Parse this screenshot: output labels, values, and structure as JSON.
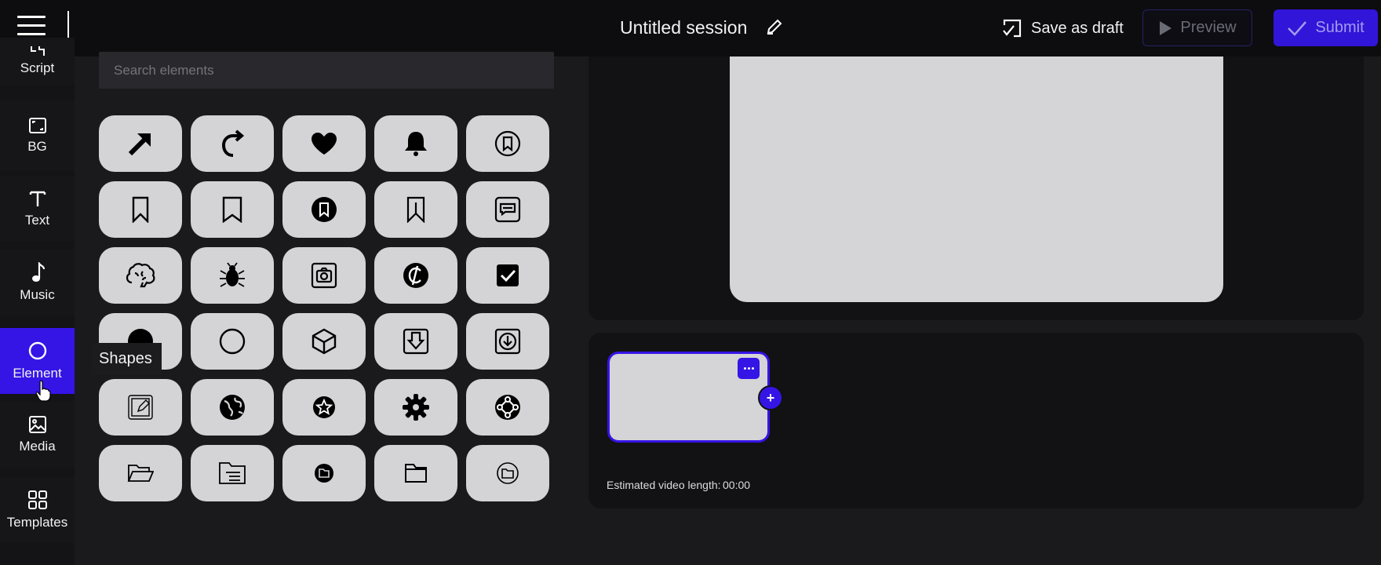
{
  "header": {
    "session_title": "Untitled session",
    "save_draft_label": "Save as draft",
    "preview_label": "Preview",
    "submit_label": "Submit"
  },
  "nav": {
    "items": [
      {
        "label": "Script",
        "icon": "script-icon"
      },
      {
        "label": "BG",
        "icon": "background-icon"
      },
      {
        "label": "Text",
        "icon": "text-icon"
      },
      {
        "label": "Music",
        "icon": "music-note-icon"
      },
      {
        "label": "Element",
        "icon": "circle-icon",
        "active": true
      },
      {
        "label": "Media",
        "icon": "image-icon"
      },
      {
        "label": "Templates",
        "icon": "templates-icon"
      }
    ]
  },
  "elements_panel": {
    "search_placeholder": "Search elements",
    "tooltip": "Shapes",
    "icons": [
      "arrow-up-right-icon",
      "redo-arrow-icon",
      "heart-icon",
      "bell-icon",
      "bookmark-circle-icon",
      "bookmark-icon",
      "bookmark-outline-icon",
      "bookmark-filled-circle-icon",
      "bookmark-alt-icon",
      "chat-box-icon",
      "brain-icon",
      "bug-icon",
      "camera-icon",
      "cent-icon",
      "checkbox-checked-icon",
      "circle-filled-icon",
      "circle-outline-icon",
      "cube-icon",
      "download-box-icon",
      "download-circle-box-icon",
      "edit-box-icon",
      "globe-icon",
      "star-circle-icon",
      "gear-icon",
      "network-icon",
      "folder-open-icon",
      "folder-document-icon",
      "folder-circle-icon",
      "folder-icon",
      "folder-circle-outline-icon"
    ]
  },
  "timeline": {
    "estimated_length_label": "Estimated video length:",
    "estimated_length_value": "00:00"
  },
  "colors": {
    "accent": "#3514e6",
    "background": "#1a191c",
    "tile": "#d4d3d5"
  }
}
